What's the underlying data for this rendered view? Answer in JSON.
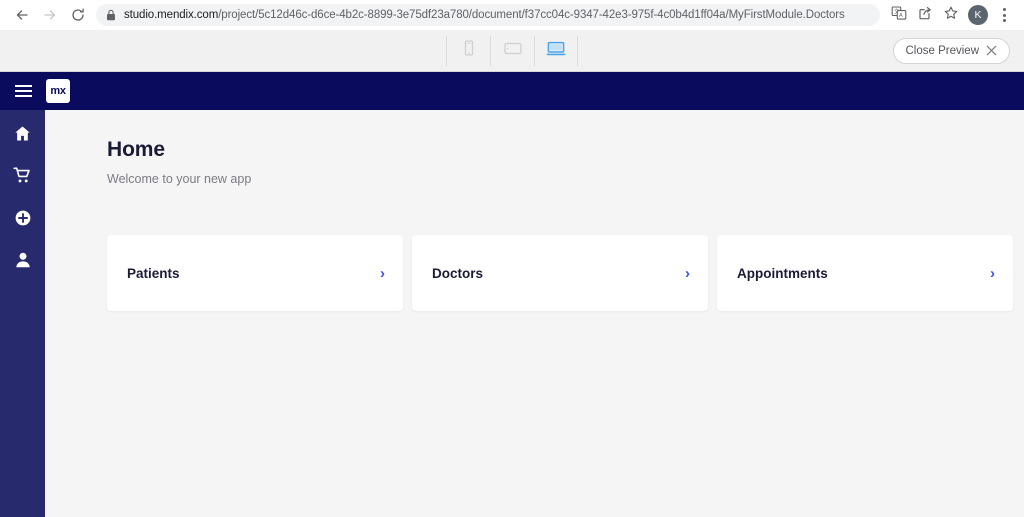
{
  "browser": {
    "back_icon": "back-arrow-icon",
    "forward_icon": "forward-arrow-icon",
    "reload_icon": "reload-icon",
    "lock_icon": "lock-icon",
    "url_host": "studio.mendix.com",
    "url_path": "/project/5c12d46c-d6ce-4b2c-8899-3e75df23a780/document/f37cc04c-9347-42e3-975f-4c0b4d1ff04a/MyFirstModule.Doctors",
    "translate_icon": "translate-icon",
    "share_icon": "share-icon",
    "bookmark_icon": "star-icon",
    "profile_initial": "K",
    "menu_icon": "kebab-menu-icon"
  },
  "preview": {
    "devices": [
      {
        "name": "phone",
        "icon": "phone-icon",
        "active": false
      },
      {
        "name": "tablet",
        "icon": "tablet-icon",
        "active": false
      },
      {
        "name": "desktop",
        "icon": "desktop-icon",
        "active": true
      }
    ],
    "close_label": "Close Preview",
    "close_icon": "close-x-icon",
    "active_color": "#4aa3e8"
  },
  "app": {
    "header": {
      "menu_icon": "hamburger-menu-icon",
      "logo_text": "mx",
      "background": "#0b0b5e"
    },
    "sidebar": {
      "background": "#272a6d",
      "items": [
        {
          "name": "home",
          "icon": "home-icon"
        },
        {
          "name": "cart",
          "icon": "shopping-cart-icon"
        },
        {
          "name": "add",
          "icon": "plus-circle-icon"
        },
        {
          "name": "profile",
          "icon": "user-icon"
        }
      ]
    },
    "page": {
      "title": "Home",
      "subtitle": "Welcome to your new app"
    },
    "cards": [
      {
        "label": "Patients",
        "chevron": "›"
      },
      {
        "label": "Doctors",
        "chevron": "›"
      },
      {
        "label": "Appointments",
        "chevron": "›"
      }
    ],
    "accent_color": "#3d52e8"
  }
}
